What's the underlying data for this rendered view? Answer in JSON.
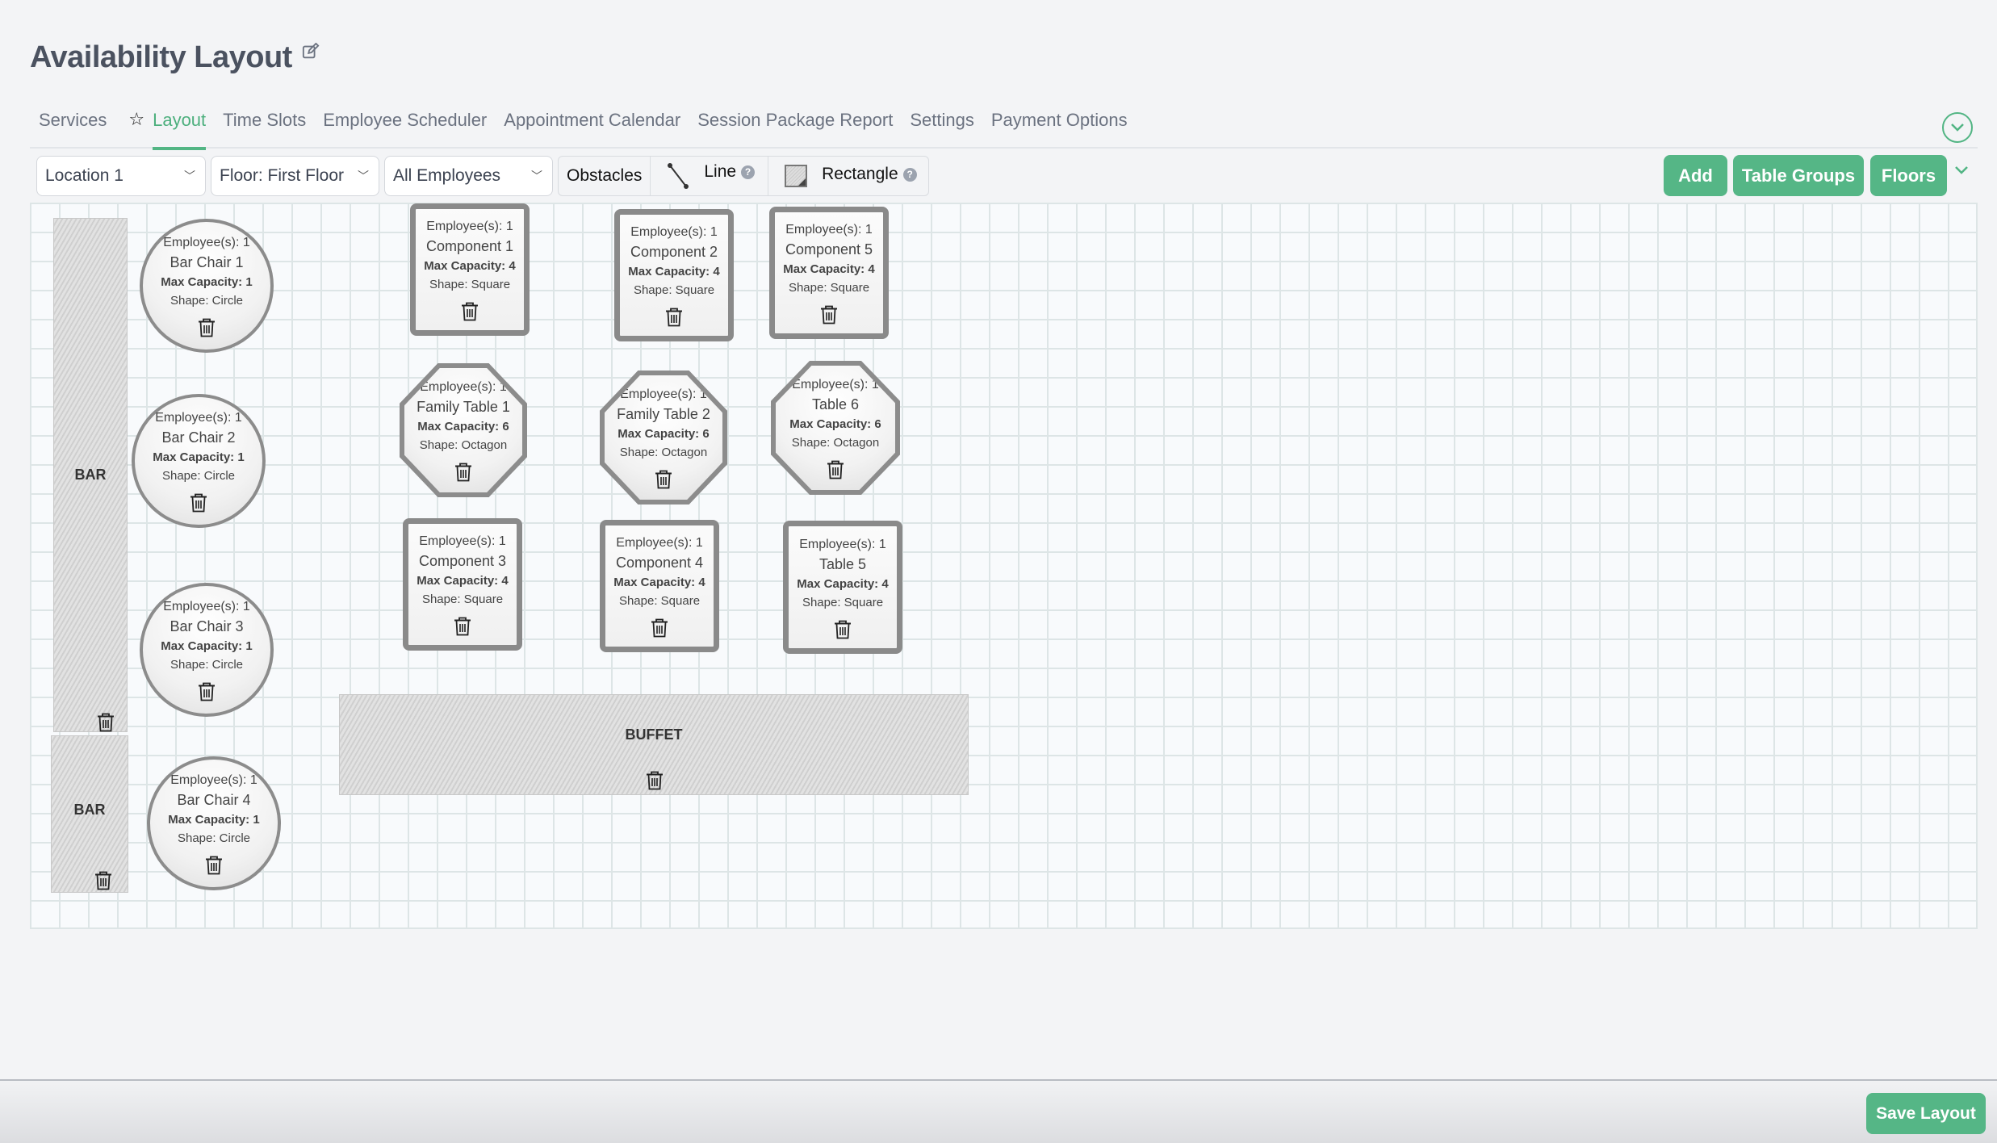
{
  "header": {
    "title": "Availability Layout",
    "edit_icon": "edit-icon"
  },
  "tabs": [
    {
      "label": "Services",
      "active": false
    },
    {
      "label": "Layout",
      "active": true,
      "icon": "star-icon"
    },
    {
      "label": "Time Slots",
      "active": false
    },
    {
      "label": "Employee Scheduler",
      "active": false
    },
    {
      "label": "Appointment Calendar",
      "active": false
    },
    {
      "label": "Session Package Report",
      "active": false
    },
    {
      "label": "Settings",
      "active": false
    },
    {
      "label": "Payment Options",
      "active": false
    }
  ],
  "toolbar": {
    "location": "Location 1",
    "floor": "Floor: First Floor",
    "employees": "All Employees",
    "obstacles_label": "Obstacles",
    "line_label": "Line",
    "rectangle_label": "Rectangle",
    "help_glyph": "?",
    "add_label": "Add",
    "table_groups_label": "Table Groups",
    "floors_label": "Floors"
  },
  "colors": {
    "accent": "#55b686",
    "table_border": "#8a8a8a",
    "grid": "#dde5e6"
  },
  "obstacles": [
    {
      "label": "BAR"
    },
    {
      "label": "BAR"
    },
    {
      "label": "BUFFET"
    }
  ],
  "tables": [
    {
      "employees": "Employee(s): 1",
      "name": "Bar Chair 1",
      "capacity": "Max Capacity: 1",
      "shape": "Shape: Circle"
    },
    {
      "employees": "Employee(s): 1",
      "name": "Bar Chair 2",
      "capacity": "Max Capacity: 1",
      "shape": "Shape: Circle"
    },
    {
      "employees": "Employee(s): 1",
      "name": "Bar Chair 3",
      "capacity": "Max Capacity: 1",
      "shape": "Shape: Circle"
    },
    {
      "employees": "Employee(s): 1",
      "name": "Bar Chair 4",
      "capacity": "Max Capacity: 1",
      "shape": "Shape: Circle"
    },
    {
      "employees": "Employee(s): 1",
      "name": "Component 1",
      "capacity": "Max Capacity: 4",
      "shape": "Shape: Square"
    },
    {
      "employees": "Employee(s): 1",
      "name": "Component 2",
      "capacity": "Max Capacity: 4",
      "shape": "Shape: Square"
    },
    {
      "employees": "Employee(s): 1",
      "name": "Component 5",
      "capacity": "Max Capacity: 4",
      "shape": "Shape: Square"
    },
    {
      "employees": "Employee(s): 1",
      "name": "Family Table 1",
      "capacity": "Max Capacity: 6",
      "shape": "Shape: Octagon"
    },
    {
      "employees": "Employee(s): 1",
      "name": "Family Table 2",
      "capacity": "Max Capacity: 6",
      "shape": "Shape: Octagon"
    },
    {
      "employees": "Employee(s): 1",
      "name": "Table 6",
      "capacity": "Max Capacity: 6",
      "shape": "Shape: Octagon"
    },
    {
      "employees": "Employee(s): 1",
      "name": "Component 3",
      "capacity": "Max Capacity: 4",
      "shape": "Shape: Square"
    },
    {
      "employees": "Employee(s): 1",
      "name": "Component 4",
      "capacity": "Max Capacity: 4",
      "shape": "Shape: Square"
    },
    {
      "employees": "Employee(s): 1",
      "name": "Table 5",
      "capacity": "Max Capacity: 4",
      "shape": "Shape: Square"
    }
  ],
  "footer": {
    "save_label": "Save Layout"
  }
}
